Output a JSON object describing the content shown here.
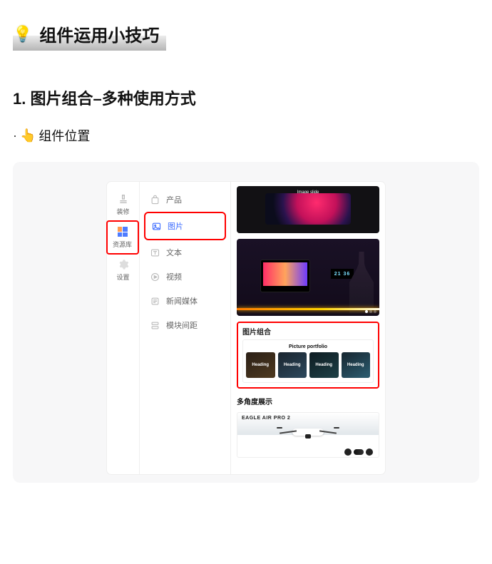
{
  "page": {
    "bulb": "💡",
    "title": "组件运用小技巧"
  },
  "section": {
    "heading": "1. 图片组合–多种使用方式",
    "bullet_dot": "·",
    "pointer": "👆",
    "location_label": "组件位置"
  },
  "sidebar": {
    "items": [
      {
        "label": "装修",
        "name": "sidebar-item-decorate"
      },
      {
        "label": "资源库",
        "name": "sidebar-item-resources",
        "selected": true
      },
      {
        "label": "设置",
        "name": "sidebar-item-settings"
      }
    ]
  },
  "menu": {
    "items": [
      {
        "label": "产品",
        "name": "menu-item-product"
      },
      {
        "label": "图片",
        "name": "menu-item-image",
        "active": true
      },
      {
        "label": "文本",
        "name": "menu-item-text"
      },
      {
        "label": "视频",
        "name": "menu-item-video"
      },
      {
        "label": "新闻媒体",
        "name": "menu-item-news"
      },
      {
        "label": "模块间距",
        "name": "menu-item-spacing"
      }
    ]
  },
  "preview": {
    "laptop_caption": "Image slide",
    "room_clock": "21 36",
    "portfolio_block_title": "图片组合",
    "portfolio_header": "Picture portfolio",
    "portfolio_cards": [
      {
        "heading": "Heading"
      },
      {
        "heading": "Heading"
      },
      {
        "heading": "Heading"
      },
      {
        "heading": "Heading"
      }
    ],
    "angle_title": "多角度展示",
    "angle_brand": "EAGLE AIR PRO 2"
  }
}
